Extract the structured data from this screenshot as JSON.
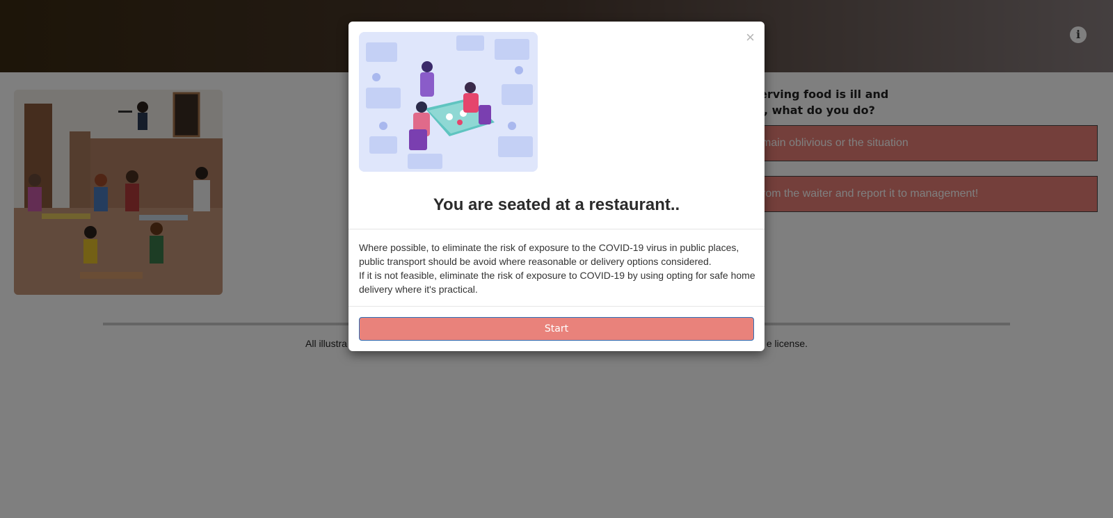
{
  "question": {
    "line1": "waiters serving food is ill and",
    "line2": "estaurant, what do you do?"
  },
  "answers": [
    "main oblivious or the situation",
    "rom the waiter and report it to management!"
  ],
  "footer": {
    "credit_left": "All illustra",
    "credit_right": "e license."
  },
  "info_icon": "info-circle-icon",
  "modal": {
    "close_label": "×",
    "title": "You are seated at a restaurant..",
    "paragraphs": [
      "Where possible, to eliminate the risk of exposure to the COVID-19 virus in public places, public transport should be avoid where reasonable or delivery options considered.",
      "If it is not feasible, eliminate the risk of exposure to COVID-19 by using opting for safe home delivery where it's practical."
    ],
    "start_label": "Start"
  },
  "colors": {
    "answer_bg": "#e97f77",
    "start_bg": "#e9827b",
    "topbar": "#3a2a12"
  }
}
